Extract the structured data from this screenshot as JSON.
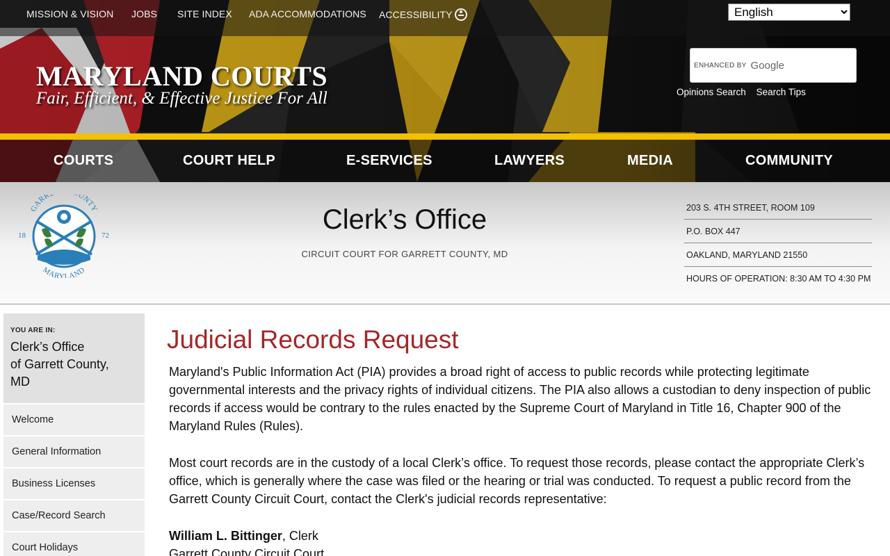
{
  "utility_nav": [
    "MISSION & VISION",
    "JOBS",
    "SITE INDEX",
    "ADA ACCOMMODATIONS",
    "ACCESSIBILITY"
  ],
  "language": {
    "selected": "English"
  },
  "brand": {
    "title": "MARYLAND COURTS",
    "tagline": "Fair, Efficient, & Effective Justice For All"
  },
  "search": {
    "enhanced_label": "ENHANCED BY",
    "provider": "Google",
    "links": [
      "Opinions Search",
      "Search Tips"
    ]
  },
  "main_nav": [
    "COURTS",
    "COURT HELP",
    "E-SERVICES",
    "LAWYERS",
    "MEDIA",
    "COMMUNITY"
  ],
  "office": {
    "title": "Clerk’s Office",
    "subtitle": "CIRCUIT COURT FOR GARRETT COUNTY, MD",
    "seal": {
      "top_text": "GARRETT COUNTY",
      "bottom_text": "MARYLAND",
      "year_left": "18",
      "year_right": "72"
    },
    "address": [
      "203 S. 4TH STREET, ROOM 109",
      "P.O. BOX 447",
      "OAKLAND, MARYLAND 21550",
      "HOURS OF OPERATION: 8:30 AM TO 4:30 PM"
    ]
  },
  "sidebar": {
    "you_are_in_label": "YOU ARE IN:",
    "location_lines": [
      "Clerk’s Office",
      "of Garrett County,",
      "MD"
    ],
    "items": [
      "Welcome",
      "General Information",
      "Business Licenses",
      "Case/Record Search",
      "Court Holidays"
    ]
  },
  "content": {
    "heading": "Judicial Records Request",
    "paragraphs": [
      "Maryland's Public Information Act (PIA) provides a broad right of access to public records while protecting legitimate governmental interests and the privacy rights of individual citizens. The PIA also allows a custodian to deny inspection of public records if access would be contrary to the rules enacted by the Supreme Court of Maryland in Title 16, Chapter 900 of the Maryland Rules (Rules).",
      "Most court records are in the custody of a local Clerk’s office. To request those records, please contact the appropriate Clerk’s office, which is generally where the case was filed or the hearing or trial was conducted. To request a public record from the Garrett County Circuit Court, contact the Clerk's judicial records representative:"
    ],
    "contact_name": "William L. Bittinger",
    "contact_title": ", Clerk",
    "contact_org": "Garrett County Circuit Court"
  },
  "colors": {
    "heading_red": "#a5262a",
    "gold": "#f2c200"
  }
}
